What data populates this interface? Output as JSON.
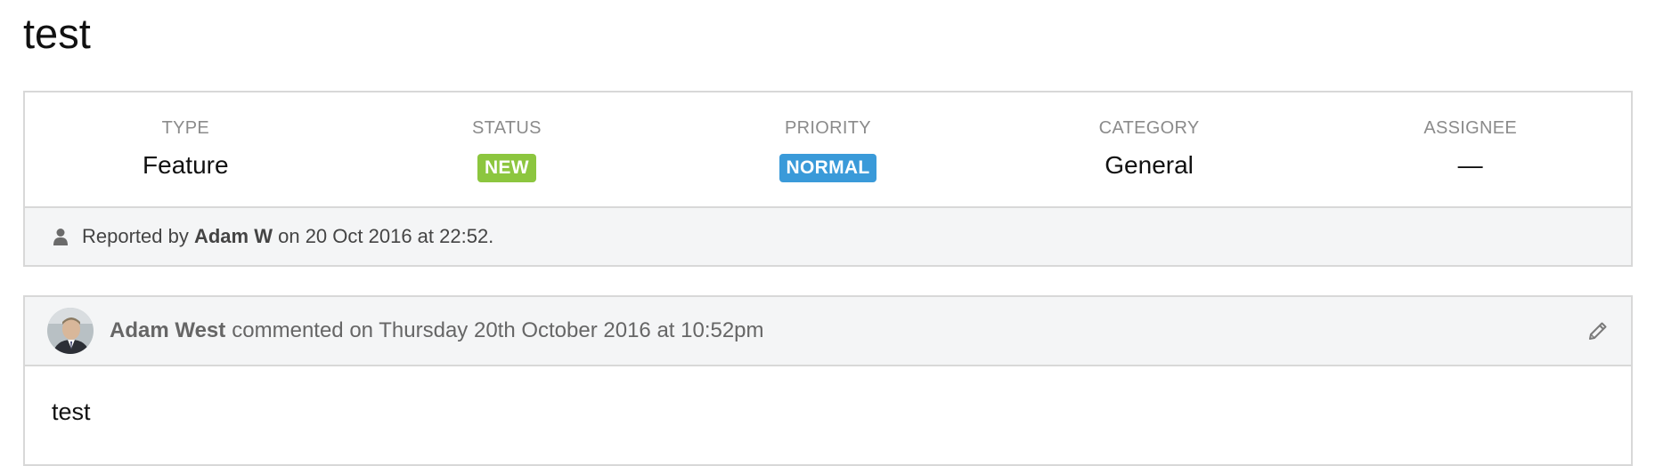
{
  "title": "test",
  "meta": {
    "type_label": "TYPE",
    "type_value": "Feature",
    "status_label": "STATUS",
    "status_value": "NEW",
    "status_color": "#8cc63f",
    "priority_label": "PRIORITY",
    "priority_value": "NORMAL",
    "priority_color": "#3a9ad9",
    "category_label": "CATEGORY",
    "category_value": "General",
    "assignee_label": "ASSIGNEE",
    "assignee_value": "—"
  },
  "reported": {
    "icon": "user-icon",
    "prefix": "Reported by",
    "author": "Adam W",
    "suffix": "on 20 Oct 2016 at 22:52."
  },
  "comment": {
    "author": "Adam West",
    "action": "commented on Thursday 20th October 2016 at 10:52pm",
    "edit_icon": "pencil-icon",
    "body": "test"
  }
}
